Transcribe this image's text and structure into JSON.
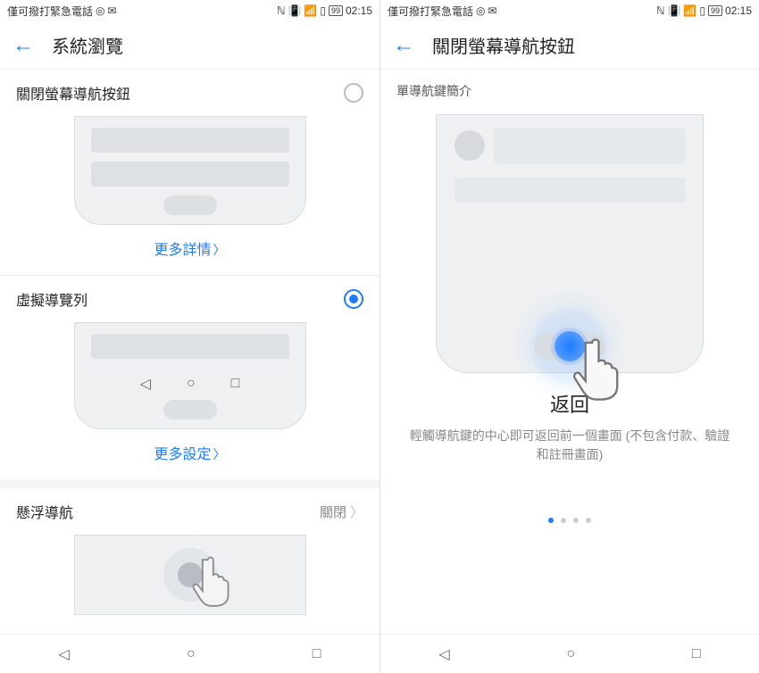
{
  "statusbar": {
    "left_text": "僅可撥打緊急電話",
    "battery": "99",
    "time": "02:15"
  },
  "left": {
    "title": "系統瀏覽",
    "option1": {
      "label": "關閉螢幕導航按鈕",
      "more": "更多詳情"
    },
    "option2": {
      "label": "虛擬導覽列",
      "more": "更多設定"
    },
    "option3": {
      "label": "懸浮導航",
      "value": "關閉"
    }
  },
  "right": {
    "title": "關閉螢幕導航按鈕",
    "section": "單導航鍵簡介",
    "tutorial_title": "返回",
    "tutorial_desc": "輕觸導航鍵的中心即可返回前一個畫面 (不包含付款、驗證和註冊畫面)"
  }
}
